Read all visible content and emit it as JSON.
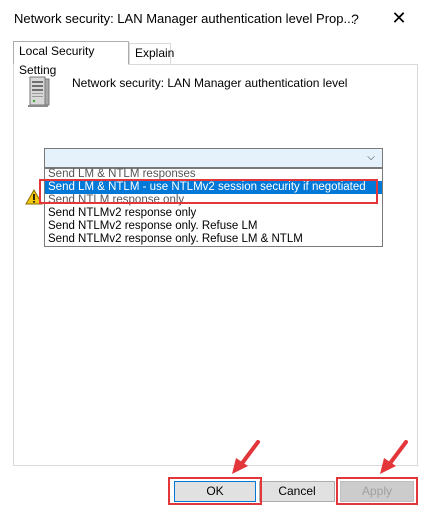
{
  "window": {
    "title": "Network security: LAN Manager authentication level Prop...",
    "help_glyph": "?",
    "close_glyph": "✕"
  },
  "tabs": [
    {
      "label": "Local Security Setting",
      "active": true
    },
    {
      "label": "Explain",
      "active": false
    }
  ],
  "policy": {
    "name": "Network security: LAN Manager authentication level",
    "icon": "server-icon"
  },
  "dropdown": {
    "current_value": "",
    "arrow_glyph": "⌵",
    "options": [
      "Send LM & NTLM responses",
      "Send LM & NTLM - use NTLMv2 session security if negotiated",
      "Send NTLM response only",
      "Send NTLMv2 response only",
      "Send NTLMv2 response only. Refuse LM",
      "Send NTLMv2 response only. Refuse LM & NTLM"
    ],
    "selected_index": 1
  },
  "buttons": {
    "ok": "OK",
    "cancel": "Cancel",
    "apply": "Apply"
  },
  "colors": {
    "annotation_red": "#e2363a",
    "selection_blue": "#0078d7"
  }
}
